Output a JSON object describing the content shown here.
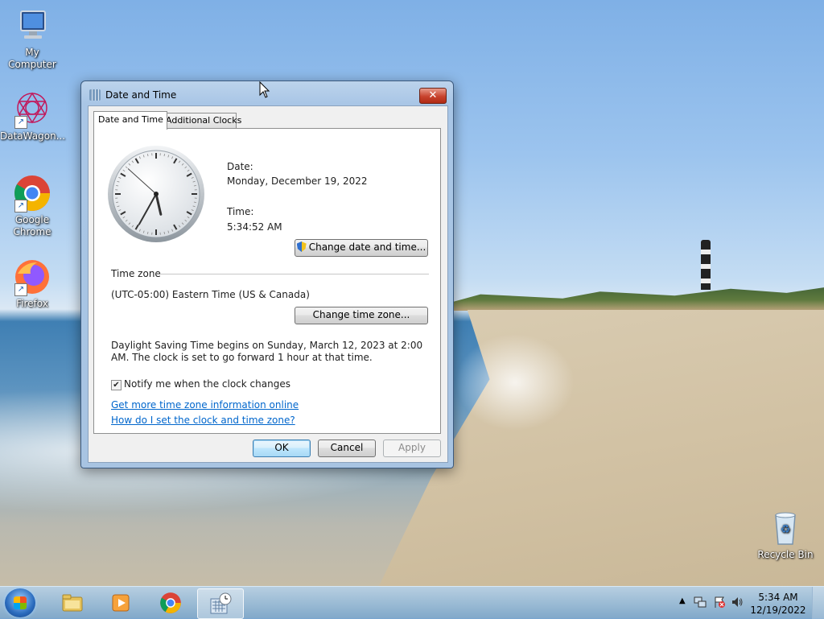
{
  "desktop": {
    "icons": [
      {
        "label": "My Computer"
      },
      {
        "label": "DataWagon..."
      },
      {
        "label": "Google Chrome"
      },
      {
        "label": "Firefox"
      },
      {
        "label": "Recycle Bin"
      }
    ]
  },
  "dialog": {
    "title": "Date and Time",
    "close_label": "✕",
    "tabs": [
      {
        "label": "Date and Time",
        "active": true
      },
      {
        "label": "Additional Clocks",
        "active": false
      }
    ],
    "date_label": "Date:",
    "date_value": "Monday, December 19, 2022",
    "time_label": "Time:",
    "time_value": "5:34:52 AM",
    "change_datetime_button": "Change date and time...",
    "timezone_header": "Time zone",
    "timezone_value": "(UTC-05:00) Eastern Time (US & Canada)",
    "change_timezone_button": "Change time zone...",
    "dst_text": "Daylight Saving Time begins on Sunday, March 12, 2023 at 2:00 AM. The clock is set to go forward 1 hour at that time.",
    "notify_checkbox_label": "Notify me when the clock changes",
    "notify_checked": true,
    "link_more_info": "Get more time zone information online",
    "link_how_set": "How do I set the clock and time zone?",
    "ok_button": "OK",
    "cancel_button": "Cancel",
    "apply_button": "Apply"
  },
  "clock": {
    "hours": 5,
    "minutes": 34,
    "seconds": 52
  },
  "taskbar": {
    "pinned": [
      "windows-explorer-icon",
      "media-player-icon",
      "chrome-icon",
      "date-time-icon"
    ],
    "time": "5:34 AM",
    "date": "12/19/2022"
  },
  "colors": {
    "link": "#0066cc",
    "close_button": "#c8432d"
  }
}
